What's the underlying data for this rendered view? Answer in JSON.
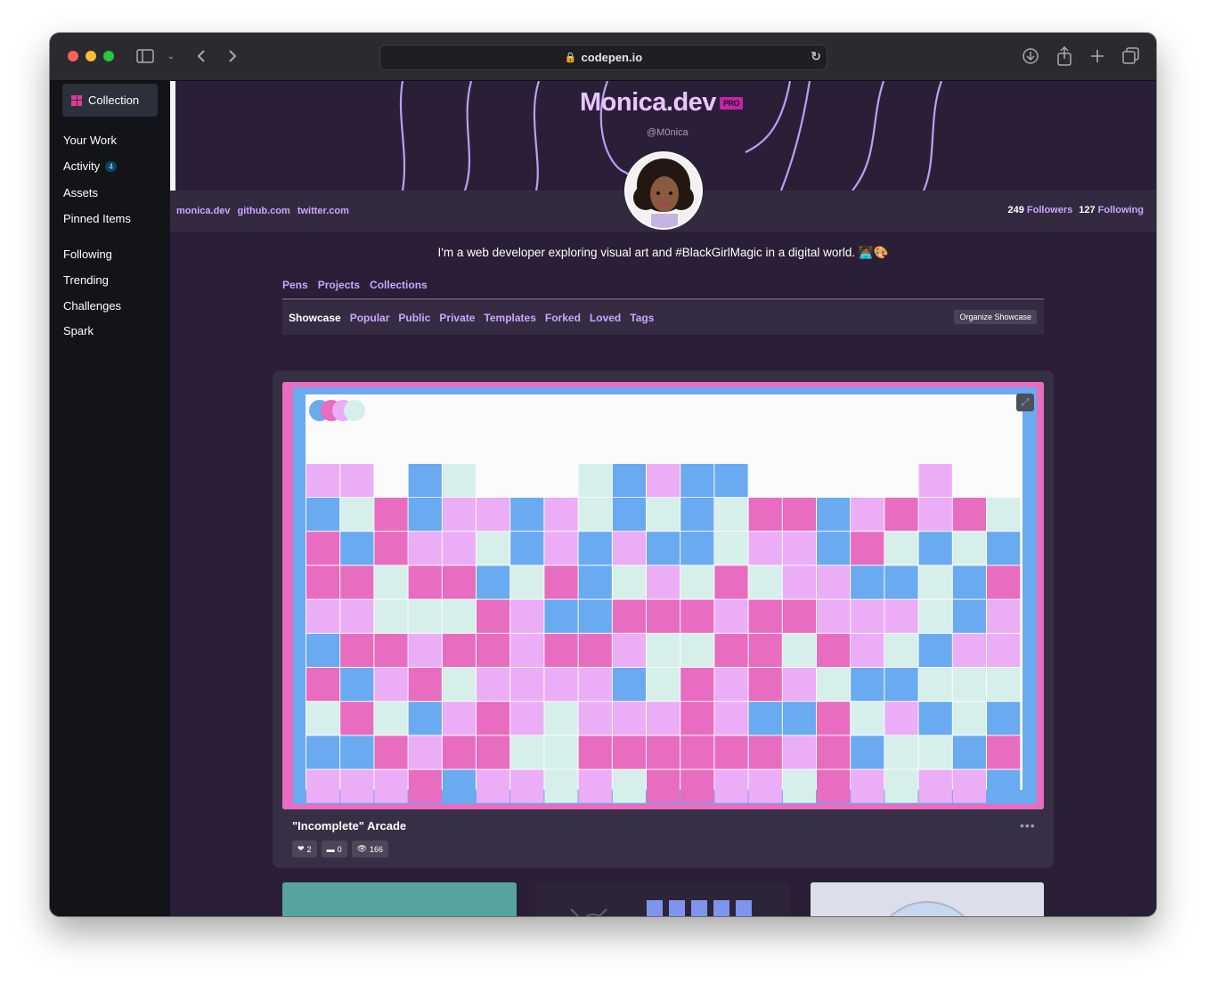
{
  "browser": {
    "url": "codepen.io"
  },
  "sidebar": {
    "collection_label": "Collection",
    "items": [
      {
        "label": "Your Work"
      },
      {
        "label": "Activity",
        "badge": "4"
      },
      {
        "label": "Assets"
      },
      {
        "label": "Pinned Items"
      },
      {
        "label": "Following"
      },
      {
        "label": "Trending"
      },
      {
        "label": "Challenges"
      },
      {
        "label": "Spark"
      }
    ]
  },
  "profile": {
    "name": "Monica.dev",
    "pro_badge": "PRO",
    "handle": "@M0nica",
    "links": [
      "monica.dev",
      "github.com",
      "twitter.com"
    ],
    "followers_count": "249",
    "followers_label": "Followers",
    "following_count": "127",
    "following_label": "Following",
    "bio": "I'm a web developer exploring visual art and #BlackGirlMagic in a digital world. 👩🏾‍💻🎨"
  },
  "tabs_primary": [
    "Pens",
    "Projects",
    "Collections"
  ],
  "tabs_secondary": [
    "Showcase",
    "Popular",
    "Public",
    "Private",
    "Templates",
    "Forked",
    "Loved",
    "Tags"
  ],
  "organize_label": "Organize Showcase",
  "showcase": {
    "title": "\"Incomplete\" Arcade",
    "likes": "2",
    "comments": "0",
    "views": "166",
    "menu": "•••"
  },
  "colors": {
    "accent": "#c9a6ff",
    "background": "#2a1f36",
    "sidebar": "#131417",
    "pink": "#e86cc0",
    "light_pink": "#ecadf7",
    "blue": "#6aaaf0",
    "mint": "#d6efea"
  }
}
